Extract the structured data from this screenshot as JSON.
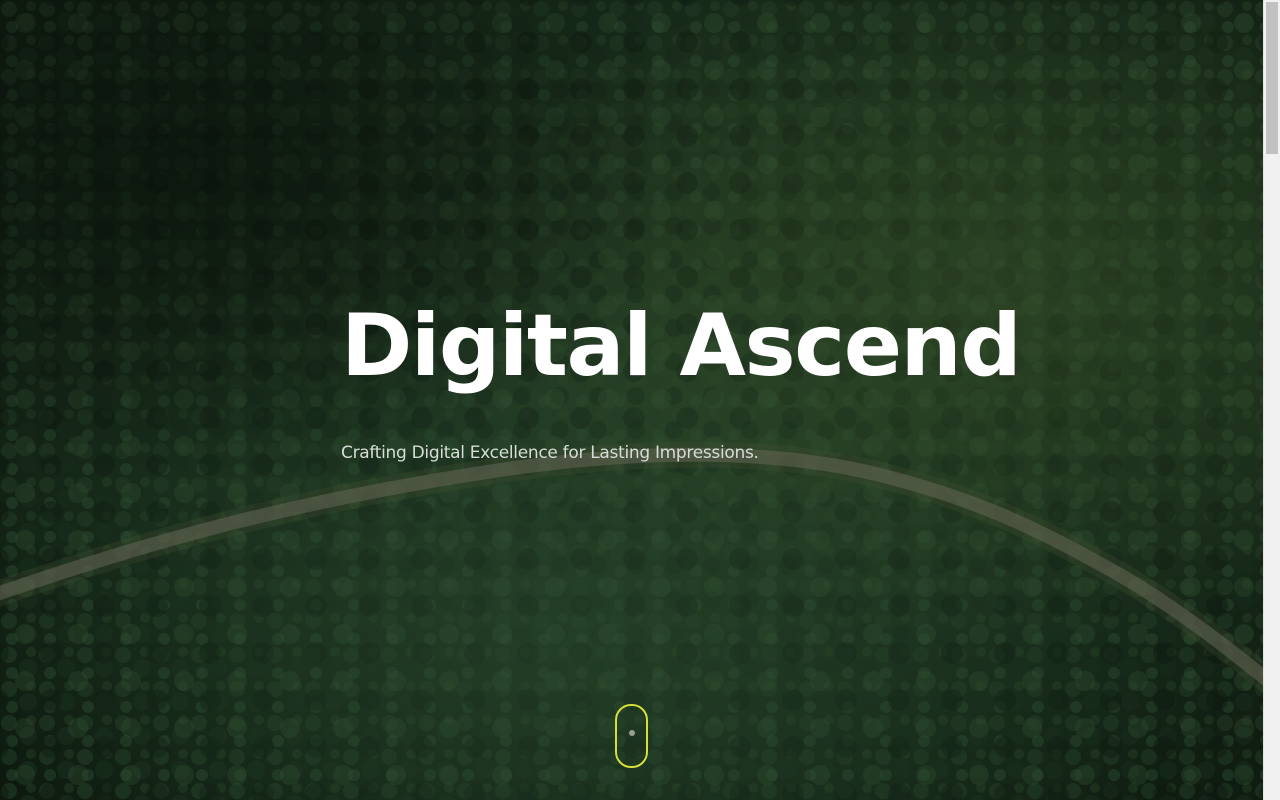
{
  "hero": {
    "title": "Digital Ascend",
    "subtitle": "Crafting Digital Excellence for Lasting Impressions.",
    "background_image": "aerial-forest-with-winding-road"
  },
  "scroll_indicator": {
    "icon": "mouse-scroll-icon",
    "border_color": "#d3df3a"
  },
  "colors": {
    "title": "#ffffff",
    "subtitle": "#d6ddd6",
    "background": "#0e1a12"
  }
}
